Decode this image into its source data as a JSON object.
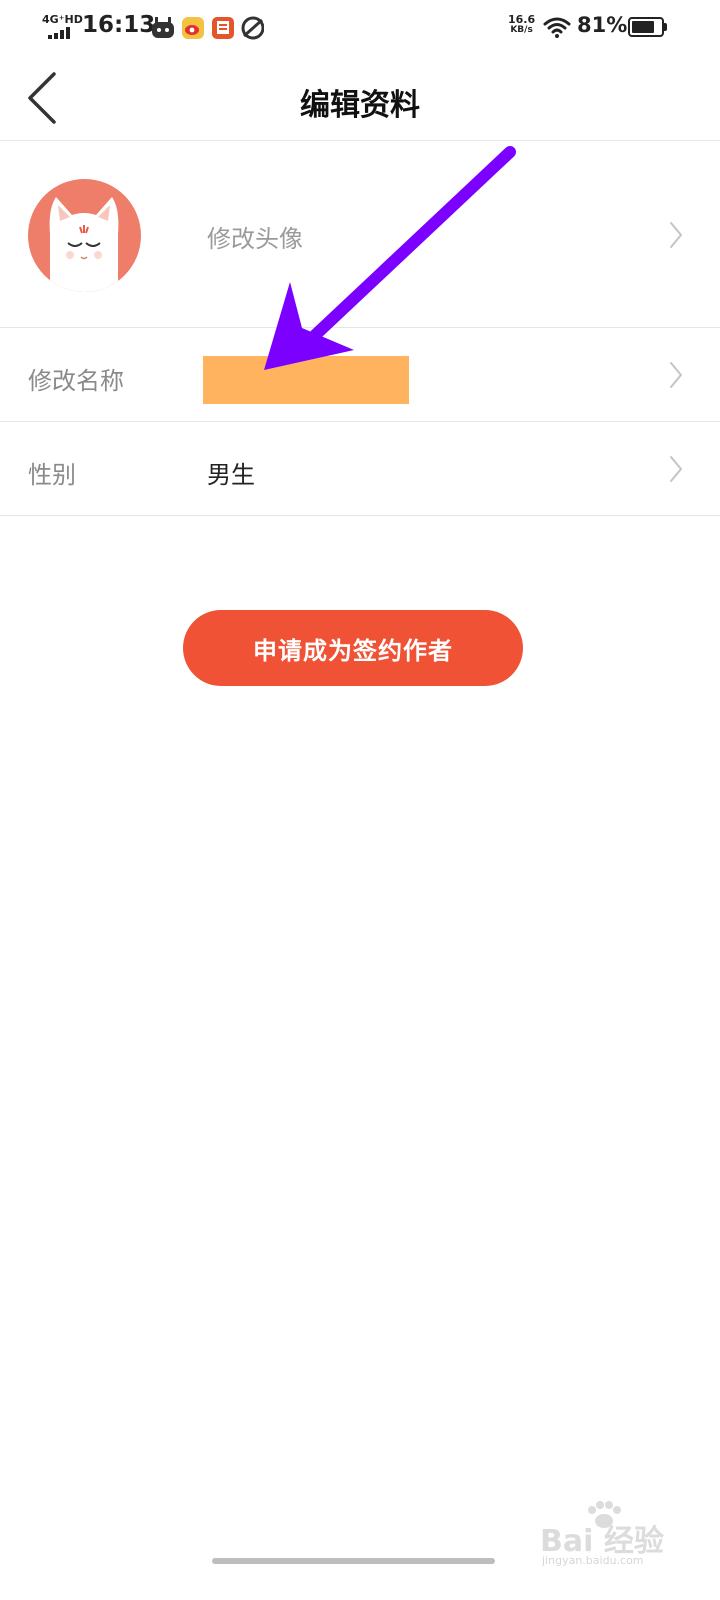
{
  "status_bar": {
    "network": "4G⁺HD",
    "time": "16:13",
    "speed_value": "16.6",
    "speed_unit": "KB/s",
    "battery_percent_text": "81%",
    "battery_level": 0.81,
    "notification_icons": [
      "robot-app-icon",
      "weibo-icon",
      "news-app-icon",
      "browser-app-icon"
    ]
  },
  "header": {
    "title": "编辑资料",
    "back_icon": "chevron-left-icon"
  },
  "rows": {
    "avatar": {
      "label": "修改头像",
      "icon": "chevron-right-icon"
    },
    "name": {
      "label": "修改名称",
      "icon": "chevron-right-icon"
    },
    "gender": {
      "label": "性别",
      "value": "男生",
      "icon": "chevron-right-icon"
    }
  },
  "actions": {
    "apply_label": "申请成为签约作者"
  },
  "colors": {
    "button": "#ef5235",
    "avatar_bg": "#ee7d69",
    "name_mask": "#ffb35e",
    "annotation_arrow": "#7b00ff"
  },
  "watermark": {
    "text": "Bai 经验",
    "sub": "jingyan.baidu.com"
  }
}
